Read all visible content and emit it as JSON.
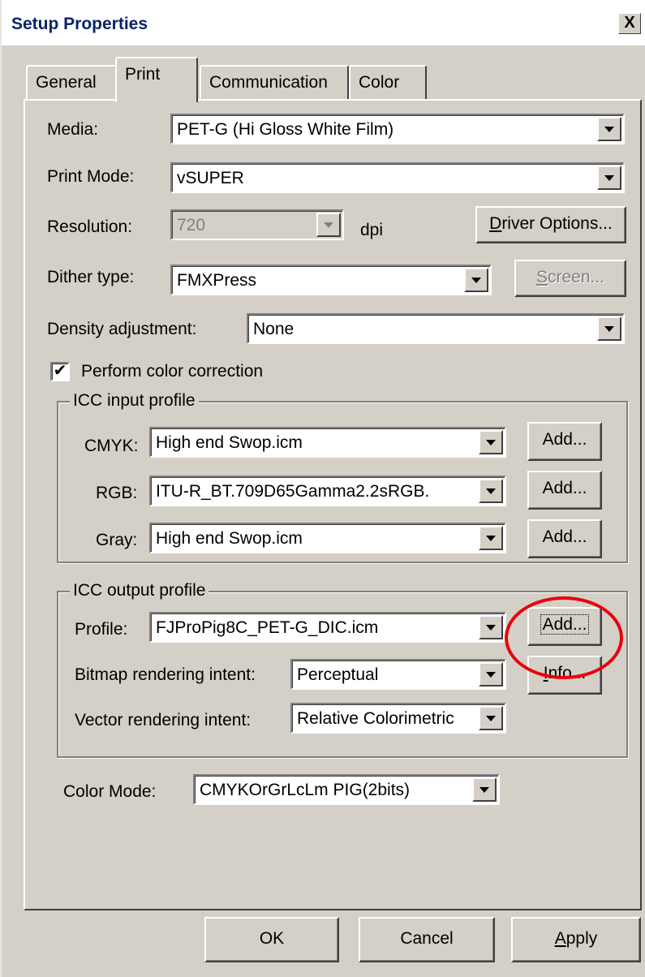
{
  "window": {
    "title": "Setup Properties",
    "close_label": "X"
  },
  "tabs": [
    {
      "label": "General"
    },
    {
      "label": "Print"
    },
    {
      "label": "Communication"
    },
    {
      "label": "Color"
    }
  ],
  "media": {
    "label": "Media:",
    "value": "PET-G (Hi Gloss White Film)"
  },
  "print_mode": {
    "label": "Print Mode:",
    "value": "vSUPER"
  },
  "resolution": {
    "label": "Resolution:",
    "value": "720",
    "unit": "dpi"
  },
  "driver_options": {
    "underlined": "D",
    "rest": "river Options..."
  },
  "dither": {
    "label": "Dither type:",
    "value": "FMXPress"
  },
  "screen_button": {
    "underlined": "S",
    "rest": "creen..."
  },
  "density": {
    "label": "Density adjustment:",
    "value": "None"
  },
  "color_correction": {
    "label": "Perform color correction",
    "checked": "✔"
  },
  "input_profile": {
    "title": "ICC input profile",
    "cmyk": {
      "label": "CMYK:",
      "value": "High end Swop.icm",
      "button": "Add..."
    },
    "rgb": {
      "label": "RGB:",
      "value": "ITU-R_BT.709D65Gamma2.2sRGB.",
      "button": "Add..."
    },
    "gray": {
      "label": "Gray:",
      "value": "High end Swop.icm",
      "button": "Add..."
    }
  },
  "output_profile": {
    "title": "ICC output profile",
    "profile": {
      "label": "Profile:",
      "value": "FJProPig8C_PET-G_DIC.icm",
      "button": "Add..."
    },
    "bitmap": {
      "label": "Bitmap rendering intent:",
      "value": "Perceptual"
    },
    "info_button": {
      "underlined": "I",
      "rest": "nfo..."
    },
    "vector": {
      "label": "Vector rendering intent:",
      "value": "Relative Colorimetric"
    }
  },
  "color_mode": {
    "label": "Color Mode:",
    "value": "CMYKOrGrLcLm PIG(2bits)"
  },
  "footer": {
    "ok": "OK",
    "cancel": "Cancel",
    "apply": {
      "underlined": "A",
      "rest": "pply"
    }
  },
  "colors": {
    "annotation": "#e8000b",
    "dialog_face": "#d4d0c8",
    "title_text": "#0a246a"
  }
}
